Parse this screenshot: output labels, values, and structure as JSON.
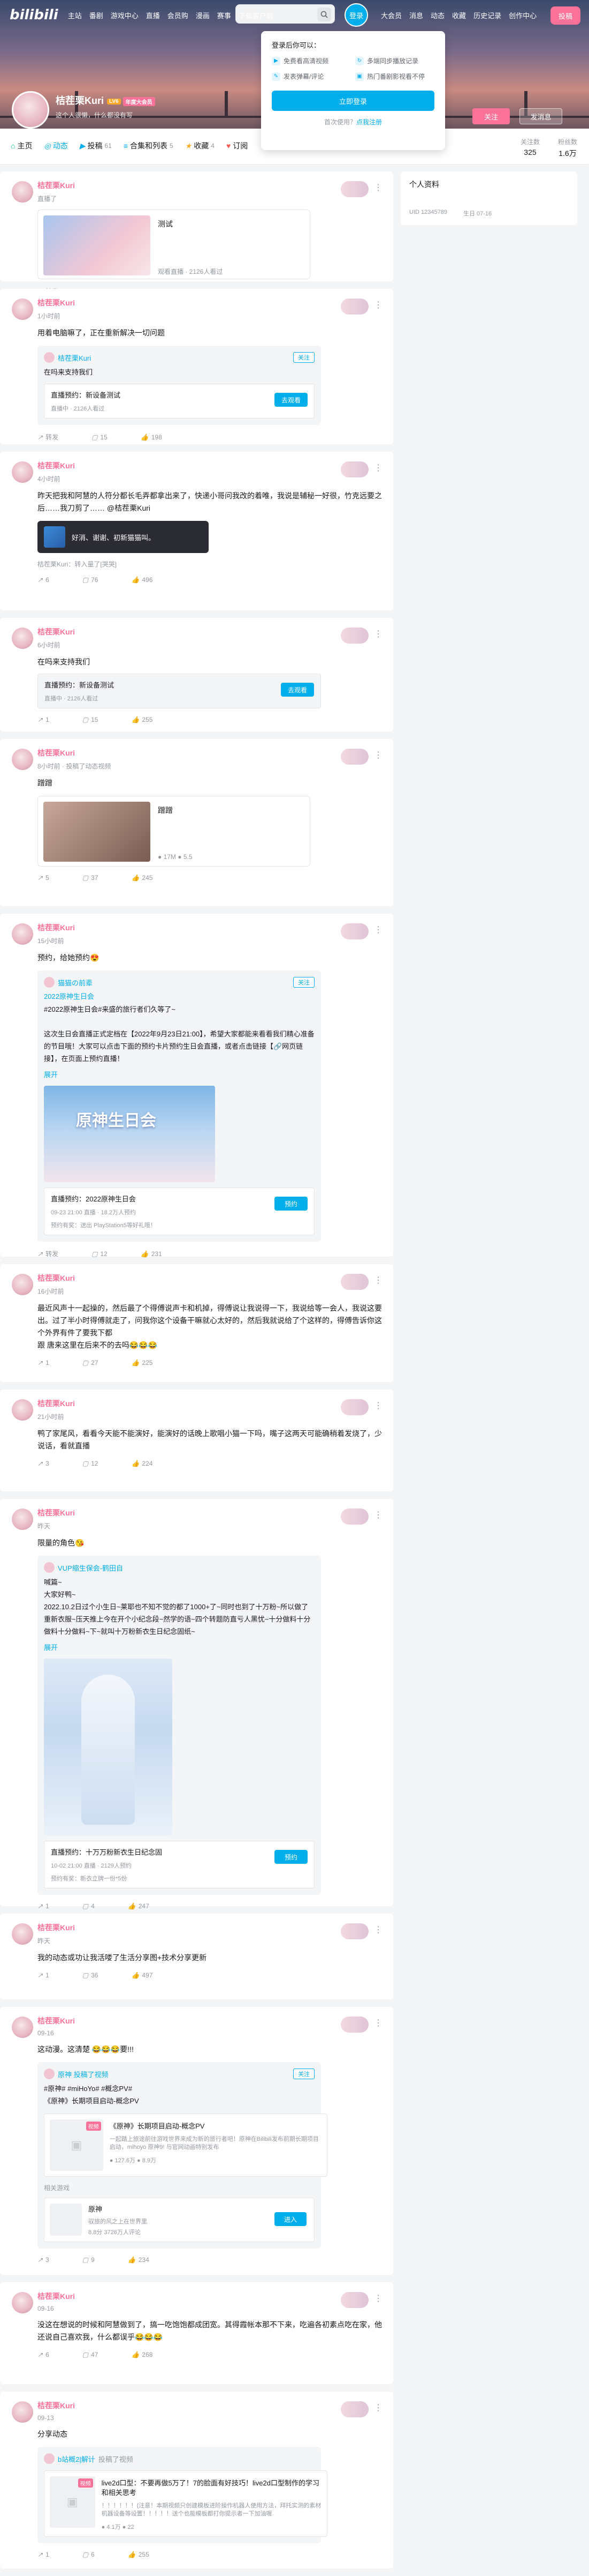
{
  "header": {
    "logo": "bilibili",
    "nav_left": [
      "主站",
      "番剧",
      "游戏中心",
      "直播",
      "会员购",
      "漫画",
      "赛事",
      "下载客户端"
    ],
    "login": "登录",
    "nav_right": [
      "大会员",
      "消息",
      "动态",
      "收藏",
      "历史记录",
      "创作中心"
    ],
    "upload": "投稿"
  },
  "login_popup": {
    "prompt": "登录后你可以：",
    "benefits": [
      "免费看高清视频",
      "多端同步播放记录",
      "发表弹幕/评论",
      "热门番剧影视看不停"
    ],
    "button": "立即登录",
    "register_prefix": "首次使用？",
    "register_link": "点我注册"
  },
  "profile": {
    "name": "桔茬栗Kuri",
    "level": "LV6",
    "vip": "年度大会员",
    "sign": "这个人很懒，什么都没有写",
    "follow": "关注",
    "message": "发消息",
    "stats": [
      {
        "label": "关注数",
        "value": "325"
      },
      {
        "label": "粉丝数",
        "value": "1.6万"
      }
    ]
  },
  "tabs": [
    {
      "icon": "⌂",
      "label": "主页",
      "count": ""
    },
    {
      "icon": "◎",
      "label": "动态",
      "count": ""
    },
    {
      "icon": "▶",
      "label": "投稿",
      "count": "61"
    },
    {
      "icon": "≡",
      "label": "合集和列表",
      "count": "5"
    },
    {
      "icon": "★",
      "label": "收藏",
      "count": "4"
    },
    {
      "icon": "♥",
      "label": "订阅",
      "count": ""
    }
  ],
  "sidebar": {
    "title": "个人资料",
    "uid": "UID  12345789",
    "birthday": "生日  07-16"
  },
  "feed": [
    {
      "time": "直播了",
      "embed_title": "测试",
      "embed_meta": "观看直播 · 2126人看过",
      "like": "转发",
      "comment": "15",
      "forward": "19"
    },
    {
      "time": "1小时前",
      "text": "用着电脑嘛了，正在重新解决一切问题",
      "fw_name": "桔茬栗Kuri",
      "fw_text": "在吗来支持我们",
      "live_title": "直播预约：新设备测试",
      "live_meta": "直播中 · 2126人看过",
      "live_btn": "去观看",
      "like": "转发",
      "comment": "15",
      "forward": "198"
    },
    {
      "time": "4小时前",
      "text": "昨天把我和阿慧的人符分都长毛弄都拿出来了，快递小哥问我改的着唯，我说是辅秘一好很，竹克远要之后……我刀剪了…… @桔茬栗Kuri",
      "bubble": "好消、谢谢、初新猫猫叫。",
      "sub": "桔茬栗Kuri：转入量了[哭哭]",
      "like": "6",
      "comment": "76",
      "forward": "496"
    },
    {
      "time": "6小时前",
      "text": "在吗来支持我们",
      "live_title": "直播预约：新设备测试",
      "live_meta": "直播中 · 2126人看过",
      "live_btn": "去观看",
      "like": "1",
      "comment": "15",
      "forward": "255"
    },
    {
      "time": "8小时前 · 投稿了动态视频",
      "text": "蹭蹭",
      "embed_title": "蹭蹭",
      "embed_meta": "● 17M  ● 5.5",
      "like": "5",
      "comment": "37",
      "forward": "245"
    },
    {
      "time": "15小时前",
      "text": "预约，给她预约😍",
      "fw_name": "猫猫の前辈",
      "fw_head": "2022原神生日会",
      "fw_text": "#2022原神生日会#来盛的旅行者们久等了~\n\n这次生日会直播正式定档在【2022年9月23日21:00】，希望大家都能来看看我们精心准备的节目哦！大家可以点击下面的预约卡片预约生日会直播，或者点击链接【🔗网页链接】，在页面上预约直播！",
      "expand": "展开",
      "poster": "原神生日会",
      "live_title": "直播预约：2022原神生日会",
      "live_meta": "09-23 21:00 直播 · 18.2万人预约",
      "live_link": "预约有奖：送出 PlayStation5等好礼哦！",
      "live_btn": "预约",
      "like": "转发",
      "comment": "12",
      "forward": "231"
    },
    {
      "time": "16小时前",
      "text": "最近风声十一起操的，然后最了个得傅说声卡和机掉，得傅说让我说得一下，我说给等一会人，我说这要出。过了半小时得傅就走了，问我你这个设备干嘛就心太好的，然后我就说给了个这样的，得傅告诉你这个外界有件了要我下都\n跟 唐来这里在后来不的去吗😂😂😂",
      "like": "1",
      "comment": "27",
      "forward": "225"
    },
    {
      "time": "21小时前",
      "text": "鸭了家尾风，看看今天能不能演好，能演好的话晚上歌唱小猫一下吗，嘴子这两天可能确稍着发烧了，少说话，看就直播",
      "like": "3",
      "comment": "12",
      "forward": "224"
    },
    {
      "time": "昨天",
      "text": "限量的角色😘",
      "fw_name": "VUP缩生保会-鹤田自",
      "fw_text": "喊篇~\n大家好鸭~\n2022.10.2日过个小生日~莱耶也不知不觉的都了1000+了~同时也到了十万粉~所以做了重新衣服~压天推上今在开个小纪念段~然学的语~四个转题防直亏人黑忧~十分做料十分做料十分做料~下~就叫十万粉新衣生日纪念固纸~",
      "expand": "展开",
      "live_title": "直播预约：十万万粉新衣生日纪念固",
      "live_meta": "10-02 21:00 直播 · 2129人预约",
      "live_link": "预约有奖：新衣立牌一份*5份",
      "live_btn": "预约",
      "like": "1",
      "comment": "4",
      "forward": "247"
    },
    {
      "time": "昨天",
      "text": "我的动态或功让我活喽了生活分享图+技术分享更新",
      "like": "1",
      "comment": "36",
      "forward": "497"
    },
    {
      "time": "09-16",
      "text": "这动漫。这清楚 😂😂😂要!!!",
      "fw_name": "原神",
      "fw_head": "原神 投稿了视频",
      "fw_text": "#原神# #miHoYo# #概念PV#\n《原神》长期项目启动-概念PV",
      "vc_title": "《原神》长期项目启动-概念PV",
      "vc_desc": "一起踏上旅途前往游戏世界来成为新的旅行者吧！原神在Bilibili发布前期长期项目启动，mihoyo 原神9! 与官网动画特别发布",
      "vc_meta": "● 127.6万  ● 8.9万",
      "game_head": "相关游戏",
      "game_name": "原神",
      "game_desc": "驭旅的风之上在世界里",
      "game_meta": "8.8分 3726万人评论",
      "game_btn": "进入",
      "like": "3",
      "comment": "9",
      "forward": "234"
    },
    {
      "time": "09-16",
      "text": "没这在想说的时候和阿慧做到了，搞一吃饱饱都成团宽。其得霞帐本那不下来，吃遍各初素点吃在家，他还说自己喜欢我，什么都误乎😂😂😂",
      "like": "6",
      "comment": "47",
      "forward": "268"
    },
    {
      "time": "09-13",
      "text": "分享动态",
      "fw_name": "b站概2|解计",
      "fw_head": "投稿了视频",
      "vc_title": "live2d口型：不要再做5万了！7的脸面有好技巧！live2d口型制作的学习和相关思考",
      "vc_desc": "！！！！！！(注意！本期视频只创建模板进阶操作机器人使用方法，拜托实测的素材机器设备等设置！！！！！送个也能模板都打你提示者一下加油喔",
      "vc_meta": "● 4.1万  ● 22",
      "like": "1",
      "comment": "6",
      "forward": "255"
    }
  ]
}
